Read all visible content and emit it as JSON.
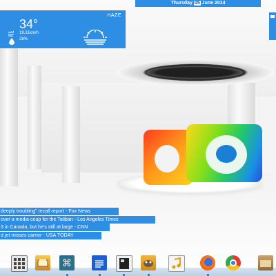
{
  "weather": {
    "condition": "HAZE",
    "temperature": "34°",
    "wind": "19.31km/h",
    "humidity": "28%",
    "wind_icon": "wind-icon",
    "humidity_icon": "droplet-icon",
    "condition_icon": "sun-haze-icon"
  },
  "datebar": {
    "weekday": "Thursday",
    "day": "05",
    "month_year": "June 2014"
  },
  "news": {
    "items": [
      "deeply troubling\" recall report - Fox News",
      "over a media coup for the Taliban - Los Angeles Times",
      "3 in Canada, but he's still at large - CNN",
      "d jet misses carrier - USA TODAY"
    ]
  },
  "dock": {
    "apps": [
      "app-grid-icon",
      "file-manager-icon",
      "command-key-icon",
      "text-editor-icon",
      "terminal-icon",
      "gimp-icon",
      "music-icon",
      "firefox-icon",
      "chrome-icon",
      "folder-icon"
    ]
  },
  "colors": {
    "accent": "#2e8ee4",
    "dock_bar": "#c8d9ea"
  }
}
